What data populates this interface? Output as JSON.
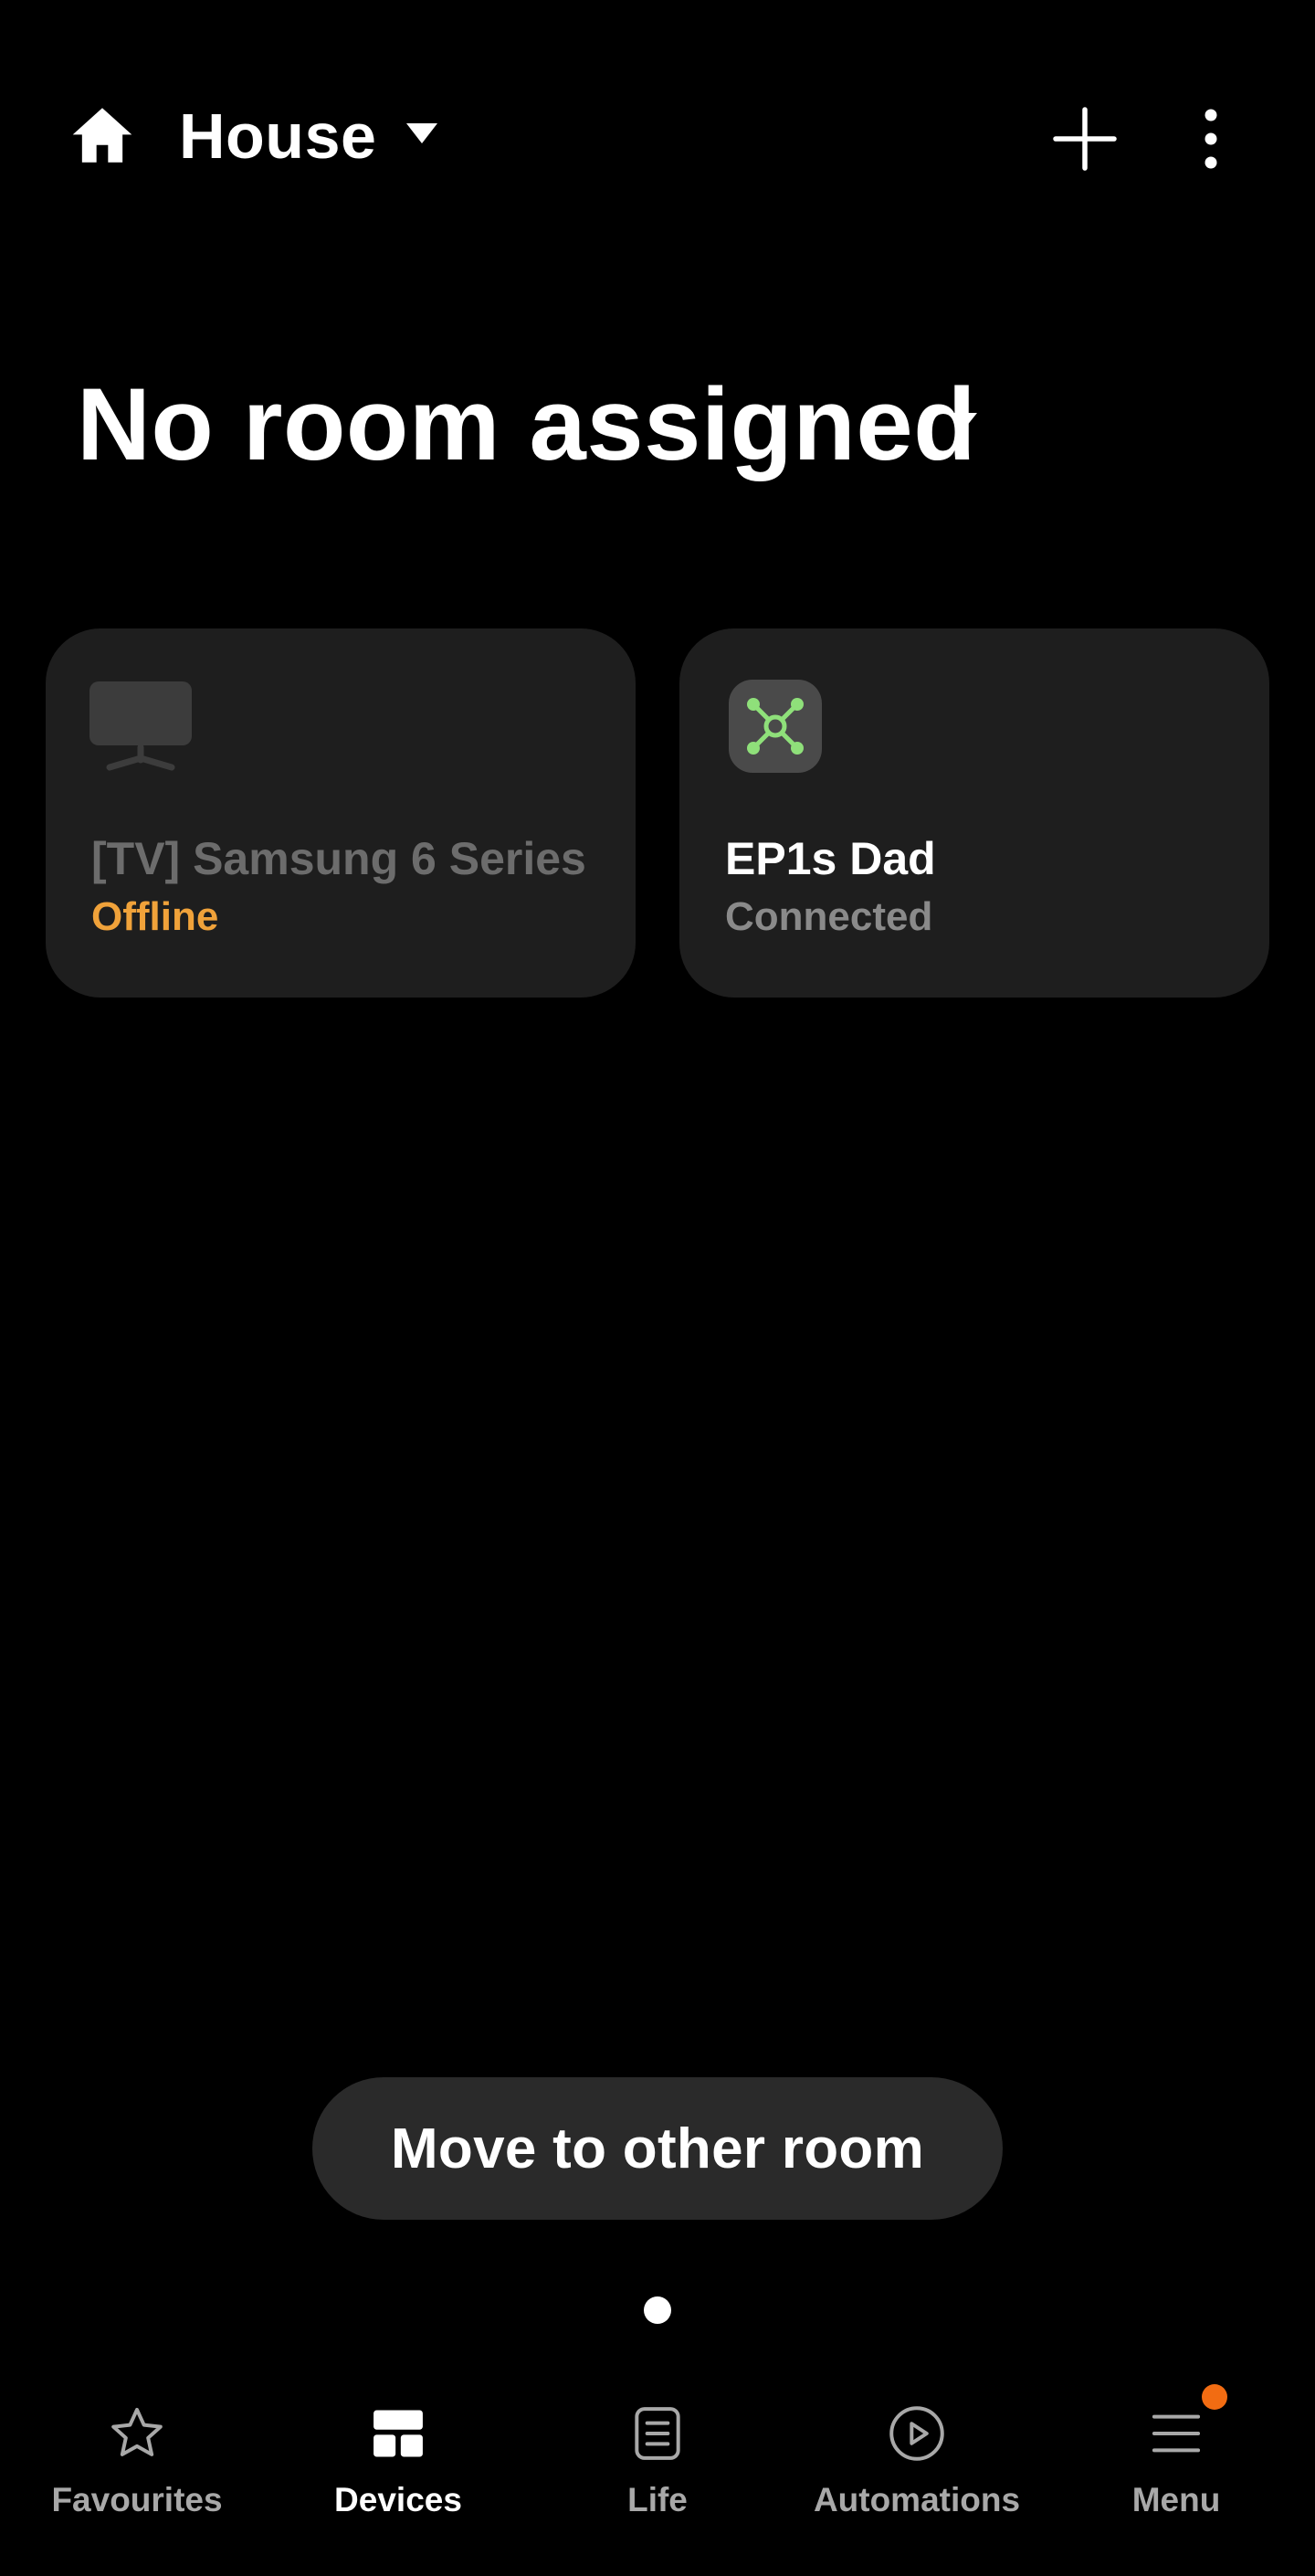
{
  "header": {
    "home_name": "House",
    "icons": {
      "home": "home-icon",
      "dropdown": "caret-down-icon",
      "add": "plus-icon",
      "more": "more-vertical-icon"
    }
  },
  "room": {
    "title": "No room assigned",
    "icon": "caret-down-icon"
  },
  "devices": [
    {
      "name": "[TV] Samsung 6 Series",
      "status": "Offline",
      "status_color": "#f0a23a",
      "icon": "tv-icon"
    },
    {
      "name": "EP1s Dad",
      "status": "Connected",
      "status_color": "#8a8a8a",
      "icon": "hub-icon",
      "icon_color": "#8fe07a"
    }
  ],
  "move_button": {
    "label": "Move to other room"
  },
  "pager": {
    "pages": 1,
    "current": 1
  },
  "bottom_nav": {
    "items": [
      {
        "label": "Favourites",
        "icon": "star-icon",
        "active": false
      },
      {
        "label": "Devices",
        "icon": "devices-grid-icon",
        "active": true
      },
      {
        "label": "Life",
        "icon": "life-icon",
        "active": false
      },
      {
        "label": "Automations",
        "icon": "play-circle-icon",
        "active": false
      },
      {
        "label": "Menu",
        "icon": "menu-icon",
        "active": false,
        "badge": true,
        "badge_color": "#f26c12"
      }
    ]
  }
}
